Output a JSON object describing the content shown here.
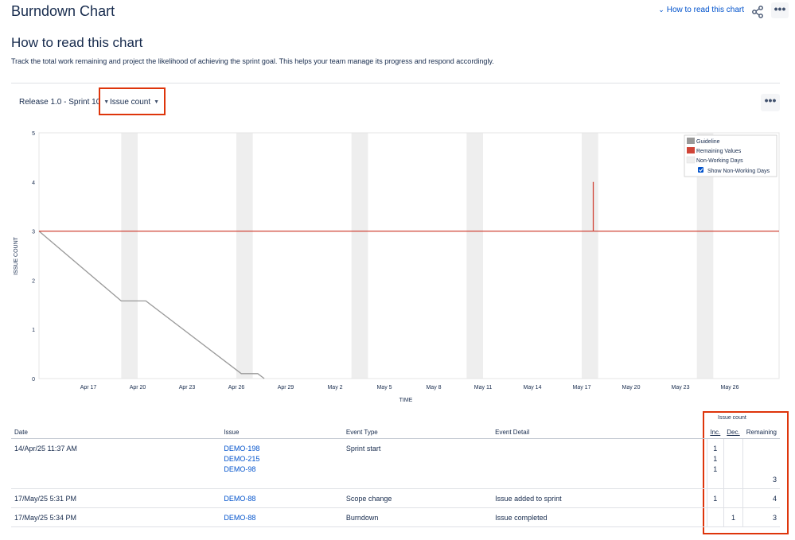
{
  "header": {
    "title": "Burndown Chart",
    "howto_link": "How to read this chart",
    "share_icon": "share-icon",
    "more_label": "•••"
  },
  "intro": {
    "title": "How to read this chart",
    "description": "Track the total work remaining and project the likelihood of achieving the sprint goal. This helps your team manage its progress and respond accordingly."
  },
  "controls": {
    "sprint_select": "Release 1.0 - Sprint 10",
    "measure_select": "Issue count",
    "more_label": "•••"
  },
  "colors": {
    "guideline": "#999999",
    "remaining": "#D04437",
    "non_working": "#EEEEEE",
    "highlight_box": "#DE350B"
  },
  "chart_data": {
    "type": "line",
    "ylabel": "ISSUE COUNT",
    "xlabel": "TIME",
    "ylim": [
      0,
      5
    ],
    "xlim": [
      "Apr 14",
      "May 29"
    ],
    "y_ticks": [
      "0",
      "1",
      "2",
      "3",
      "4",
      "5"
    ],
    "x_ticks": [
      "Apr 17",
      "Apr 20",
      "Apr 23",
      "Apr 26",
      "Apr 29",
      "May 2",
      "May 5",
      "May 8",
      "May 11",
      "May 14",
      "May 17",
      "May 20",
      "May 23",
      "May 26"
    ],
    "series": [
      {
        "name": "Guideline",
        "points": [
          [
            "Apr 14",
            3
          ],
          [
            "Apr 19",
            1.58
          ],
          [
            "Apr 20.5",
            1.58
          ],
          [
            "Apr 26.3",
            0.1
          ],
          [
            "Apr 27.3",
            0.1
          ],
          [
            "Apr 27.7",
            0
          ]
        ]
      },
      {
        "name": "Remaining Values",
        "points": [
          [
            "Apr 14",
            3
          ],
          [
            "May 17.7",
            3
          ],
          [
            "May 17.7",
            4
          ],
          [
            "May 17.7",
            3
          ],
          [
            "May 29",
            3
          ]
        ]
      }
    ],
    "non_working_days": [
      [
        "Apr 19.0",
        "Apr 20.0"
      ],
      [
        "Apr 26.0",
        "Apr 27.0"
      ],
      [
        "May 3.0",
        "May 4.0"
      ],
      [
        "May 10.0",
        "May 11.0"
      ],
      [
        "May 17.0",
        "May 18.0"
      ],
      [
        "May 24.0",
        "May 25.0"
      ]
    ],
    "legend": {
      "placement": "top-right",
      "items": [
        "Guideline",
        "Remaining Values",
        "Non-Working Days"
      ],
      "checkbox_label": "Show Non-Working Days",
      "checkbox_checked": true
    }
  },
  "table": {
    "group_header": "Issue count",
    "columns": {
      "date": "Date",
      "issue": "Issue",
      "event_type": "Event Type",
      "event_detail": "Event Detail",
      "inc": "Inc.",
      "dec": "Dec.",
      "remaining": "Remaining"
    },
    "rows": [
      {
        "date": "14/Apr/25 11:37 AM",
        "issues": [
          "DEMO-198",
          "DEMO-215",
          "DEMO-98"
        ],
        "event_type": "Sprint start",
        "event_detail": "",
        "inc": [
          "1",
          "1",
          "1"
        ],
        "dec": [],
        "remaining": "3"
      },
      {
        "date": "17/May/25 5:31 PM",
        "issues": [
          "DEMO-88"
        ],
        "event_type": "Scope change",
        "event_detail": "Issue added to sprint",
        "inc": [
          "1"
        ],
        "dec": [],
        "remaining": "4"
      },
      {
        "date": "17/May/25 5:34 PM",
        "issues": [
          "DEMO-88"
        ],
        "event_type": "Burndown",
        "event_detail": "Issue completed",
        "inc": [],
        "dec": [
          "1"
        ],
        "remaining": "3"
      }
    ]
  }
}
